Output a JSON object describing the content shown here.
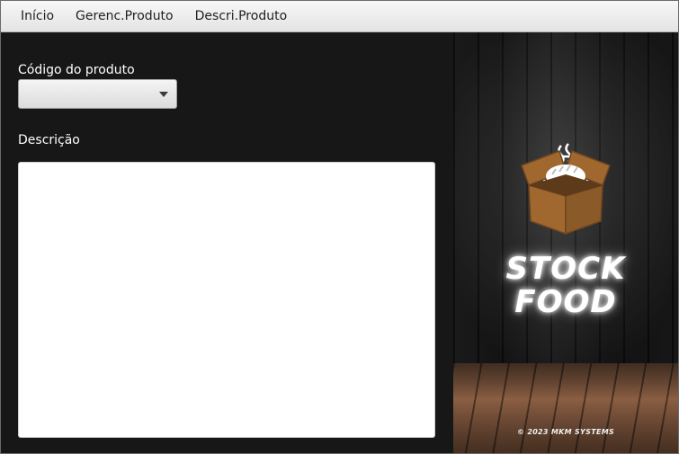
{
  "menu": {
    "items": [
      {
        "label": "Início"
      },
      {
        "label": "Gerenc.Produto"
      },
      {
        "label": "Descri.Produto"
      }
    ]
  },
  "form": {
    "product_code_label": "Código do produto",
    "product_code_value": "",
    "description_label": "Descrição",
    "description_value": ""
  },
  "branding": {
    "title_line1": "STOCK",
    "title_line2": "FOOD",
    "copyright": "© 2023 MKM SYSTEMS",
    "box_color": "#a0682f",
    "box_dark": "#6e4520",
    "bread_color": "#ffffff"
  }
}
